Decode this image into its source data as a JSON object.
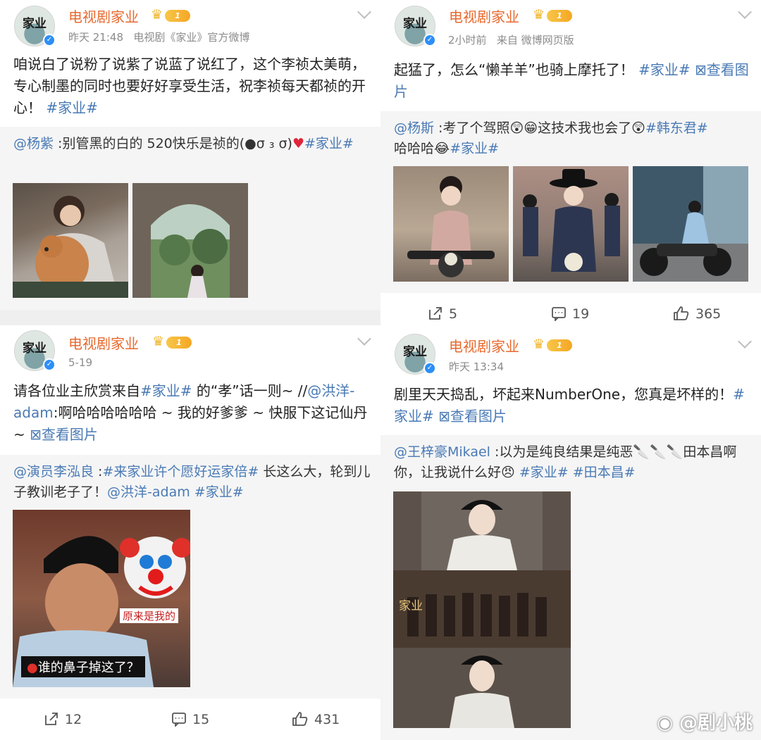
{
  "account": {
    "name": "电视剧家业",
    "avatar_text": "家业",
    "vip_level": "1"
  },
  "posts": [
    {
      "time": "昨天 21:48",
      "source": "电视剧《家业》官方微博",
      "text": "咱说白了说粉了说紫了说蓝了说红了，这个李祯太美萌，专心制墨的同时也要好好享受生活，祝李祯每天都祯的开心！",
      "tag": "#家业#",
      "repost_user": "@杨紫",
      "repost_text": " :别管黑的白的 520快乐是祯的(●σ ₃ σ)",
      "repost_heart": "♥",
      "repost_tag": "#家业#"
    },
    {
      "time": "2小时前",
      "source": "来自 微博网页版",
      "text": "起猛了，怎么“懒羊羊”也骑上摩托了！",
      "tag": "#家业#",
      "view_pics": "查看图片",
      "repost_user": "@杨斯",
      "repost_text": " :考了个驾照😲😁这技术我也会了😲",
      "repost_tag": "#韩东君#",
      "repost_text2": "哈哈哈😂",
      "repost_tag2": "#家业#",
      "reposts": "5",
      "comments": "19",
      "likes": "365"
    },
    {
      "time": "5-19",
      "text": "请各位业主欣赏来自",
      "tag": "#家业#",
      "text_b": " 的“孝”话一则~ //",
      "mention": "@洪洋-adam",
      "text_c": ":啊哈哈哈哈哈哈 ~ 我的好爹爹 ~ 快服下这记仙丹 ~",
      "view_pics": "查看图片",
      "repost_user": "@演员李泓良",
      "repost_tag": "#来家业许个愿好运家倍#",
      "repost_text": " 长这么大，轮到儿子教训老子了！",
      "repost_mention": "@洪洋-adam",
      "repost_tag2": "#家业#",
      "img_caption_top": "原来是我的",
      "img_caption_bottom": "谁的鼻子掉这了？",
      "reposts": "12",
      "comments": "15",
      "likes": "431"
    },
    {
      "time": "昨天 13:34",
      "text": "剧里天天捣乱，坏起来NumberOne，您真是坏样的！",
      "tag": "#家业#",
      "view_pics": "查看图片",
      "repost_user": "@王梓豪Mikael",
      "repost_text": " :以为是纯良结果是纯恶🔪🔪🔪田本昌啊你，让我说什么好😠",
      "repost_tag": "#家业#",
      "repost_tag2": "#田本昌#",
      "img_overlay": "家业"
    }
  ],
  "watermark": "@剧小桃",
  "colors": {
    "name": "#e8692e",
    "link": "#4a7ab5",
    "bg": "#efefef",
    "repost_bg": "#f5f5f5"
  }
}
